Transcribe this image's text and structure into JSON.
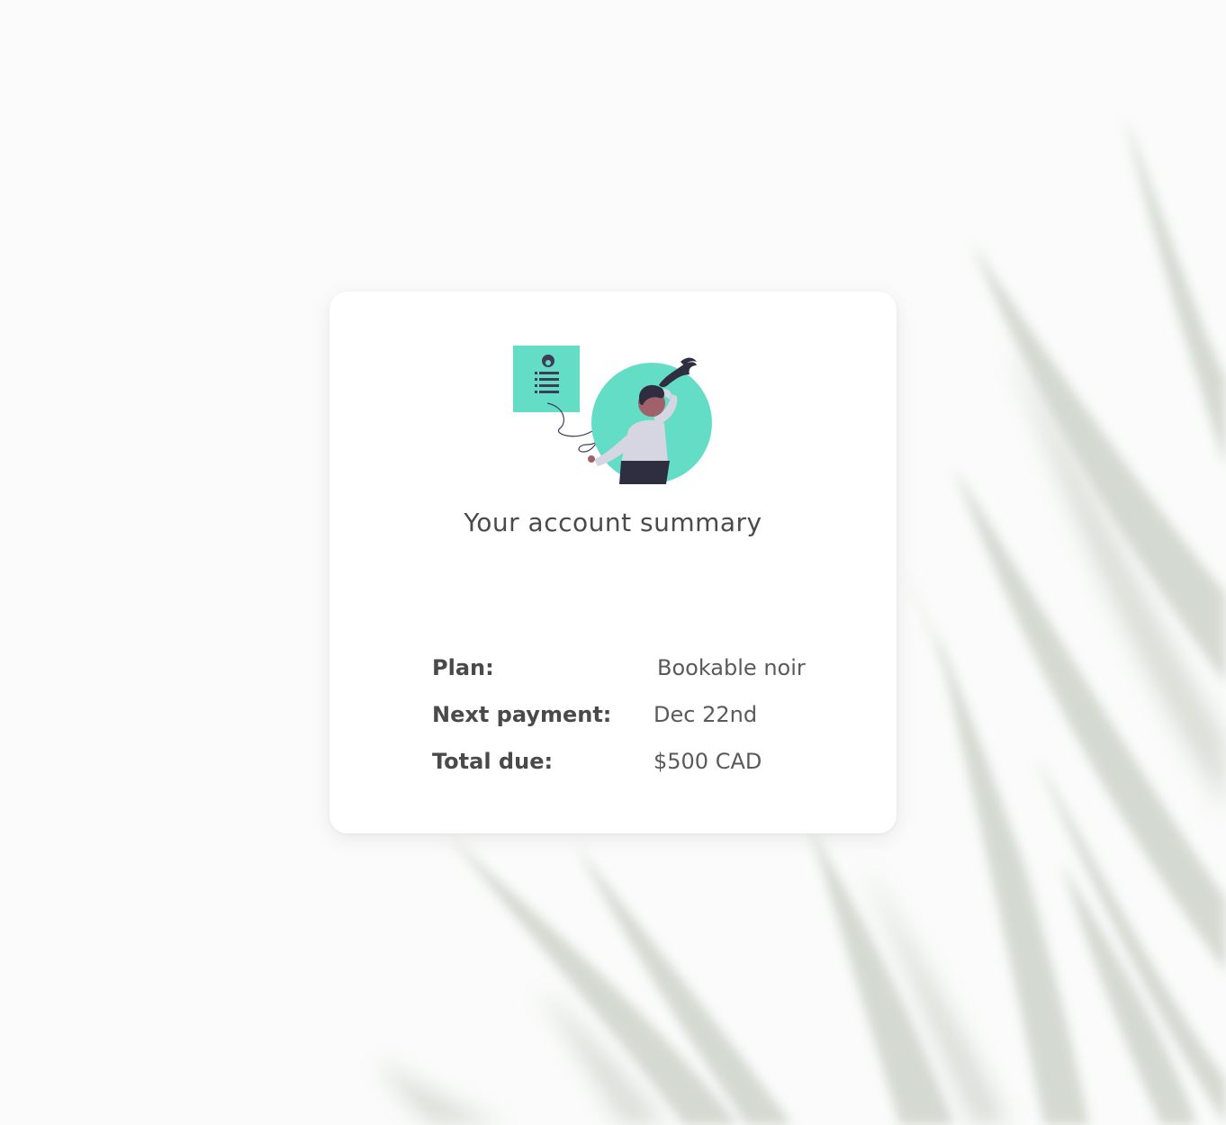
{
  "card": {
    "title": "Your account summary",
    "rows": [
      {
        "label": "Plan:",
        "value": "Bookable noir"
      },
      {
        "label": "Next payment:",
        "value": "Dec 22nd"
      },
      {
        "label": "Total due:",
        "value": "$500 CAD"
      }
    ]
  },
  "colors": {
    "accent": "#63ddc5",
    "text_dark": "#4a4a4a",
    "card_bg": "#ffffff",
    "page_bg": "#fafbfa",
    "leaf": "#c9d0c6"
  },
  "icons": {
    "illustration": "woman-holding-document-illustration",
    "document": "document-icon",
    "background": "plant-leaves-background"
  }
}
